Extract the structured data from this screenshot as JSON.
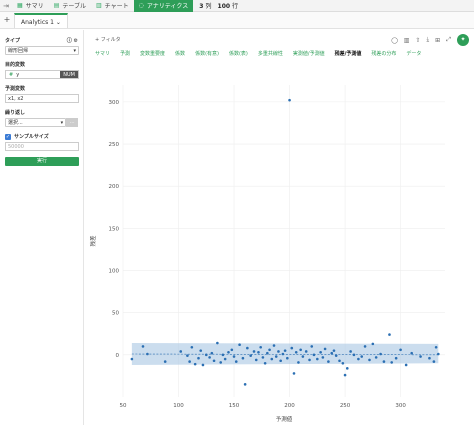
{
  "topbar": {
    "tabs": [
      {
        "icon": "summary-icon",
        "label": "サマリ"
      },
      {
        "icon": "table-icon",
        "label": "テーブル"
      },
      {
        "icon": "chart-icon",
        "label": "チャート"
      },
      {
        "icon": "bulb-icon",
        "label": "アナリティクス"
      }
    ],
    "cols": "3",
    "cols_unit": "列",
    "rows": "100",
    "rows_unit": "行"
  },
  "subbar": {
    "add": "+",
    "tab": "Analytics 1",
    "tab_caret": "⌄"
  },
  "sidebar": {
    "type_label": "タイプ",
    "type_value": "線形回帰",
    "target_label": "目的変数",
    "target_value": "y",
    "target_type": "NUM",
    "pred_label": "予測変数",
    "pred_value": "x1, x2",
    "repeat_label": "繰り返し",
    "repeat_value": "選択...",
    "sample_label": "サンプルサイズ",
    "sample_placeholder": "50000",
    "run_label": "実行"
  },
  "main": {
    "filter": "+ フィルタ",
    "nav": [
      "サマリ",
      "予測",
      "変数重要度",
      "係数",
      "係数(有意)",
      "係数(表)",
      "多重共線性",
      "実測値/予測値",
      "残差/予測値",
      "残差の分布",
      "データ"
    ],
    "active_nav": "残差/予測値"
  },
  "chart_data": {
    "type": "scatter",
    "xlabel": "予測値",
    "ylabel": "残差",
    "xlim": [
      50,
      340
    ],
    "ylim": [
      -50,
      320
    ],
    "xticks": [
      50,
      100,
      150,
      200,
      250,
      300
    ],
    "yticks": [
      0,
      50,
      100,
      150,
      200,
      250,
      300
    ],
    "points": [
      [
        58,
        -5
      ],
      [
        68,
        10
      ],
      [
        72,
        1
      ],
      [
        88,
        -8
      ],
      [
        102,
        4
      ],
      [
        108,
        -1
      ],
      [
        110,
        -8
      ],
      [
        112,
        9
      ],
      [
        115,
        -11
      ],
      [
        118,
        -4
      ],
      [
        120,
        5
      ],
      [
        122,
        -12
      ],
      [
        125,
        0
      ],
      [
        128,
        -3
      ],
      [
        130,
        2
      ],
      [
        132,
        -7
      ],
      [
        135,
        14
      ],
      [
        138,
        -9
      ],
      [
        140,
        0
      ],
      [
        142,
        -5
      ],
      [
        145,
        3
      ],
      [
        148,
        6
      ],
      [
        150,
        -2
      ],
      [
        152,
        -8
      ],
      [
        155,
        12
      ],
      [
        158,
        -4
      ],
      [
        160,
        -35
      ],
      [
        162,
        8
      ],
      [
        165,
        -1
      ],
      [
        168,
        4
      ],
      [
        170,
        -6
      ],
      [
        172,
        3
      ],
      [
        174,
        9
      ],
      [
        176,
        -3
      ],
      [
        178,
        -10
      ],
      [
        180,
        2
      ],
      [
        182,
        6
      ],
      [
        184,
        -5
      ],
      [
        186,
        11
      ],
      [
        188,
        -2
      ],
      [
        190,
        4
      ],
      [
        192,
        -7
      ],
      [
        194,
        1
      ],
      [
        196,
        5
      ],
      [
        198,
        -4
      ],
      [
        200,
        302
      ],
      [
        202,
        8
      ],
      [
        204,
        -22
      ],
      [
        206,
        3
      ],
      [
        208,
        -9
      ],
      [
        210,
        6
      ],
      [
        212,
        -2
      ],
      [
        215,
        4
      ],
      [
        218,
        -6
      ],
      [
        220,
        10
      ],
      [
        222,
        0
      ],
      [
        225,
        -5
      ],
      [
        228,
        3
      ],
      [
        230,
        -3
      ],
      [
        232,
        7
      ],
      [
        235,
        -8
      ],
      [
        238,
        2
      ],
      [
        240,
        5
      ],
      [
        242,
        -1
      ],
      [
        245,
        -7
      ],
      [
        248,
        -10
      ],
      [
        250,
        -24
      ],
      [
        252,
        -16
      ],
      [
        255,
        4
      ],
      [
        258,
        0
      ],
      [
        262,
        -5
      ],
      [
        265,
        -2
      ],
      [
        268,
        10
      ],
      [
        272,
        -6
      ],
      [
        275,
        13
      ],
      [
        278,
        -3
      ],
      [
        282,
        1
      ],
      [
        285,
        -8
      ],
      [
        290,
        24
      ],
      [
        292,
        -9
      ],
      [
        296,
        -4
      ],
      [
        300,
        6
      ],
      [
        305,
        -12
      ],
      [
        310,
        2
      ],
      [
        318,
        -2
      ],
      [
        326,
        -4
      ],
      [
        330,
        -8
      ],
      [
        332,
        9
      ],
      [
        334,
        1
      ]
    ],
    "band": {
      "x": [
        58,
        334
      ],
      "lower": [
        -12,
        -10
      ],
      "upper": [
        14,
        13
      ],
      "center": [
        1,
        0
      ]
    }
  },
  "colors": {
    "accent": "#2e9e58",
    "point": "#2b6fb3",
    "band": "#a9c6e3"
  }
}
